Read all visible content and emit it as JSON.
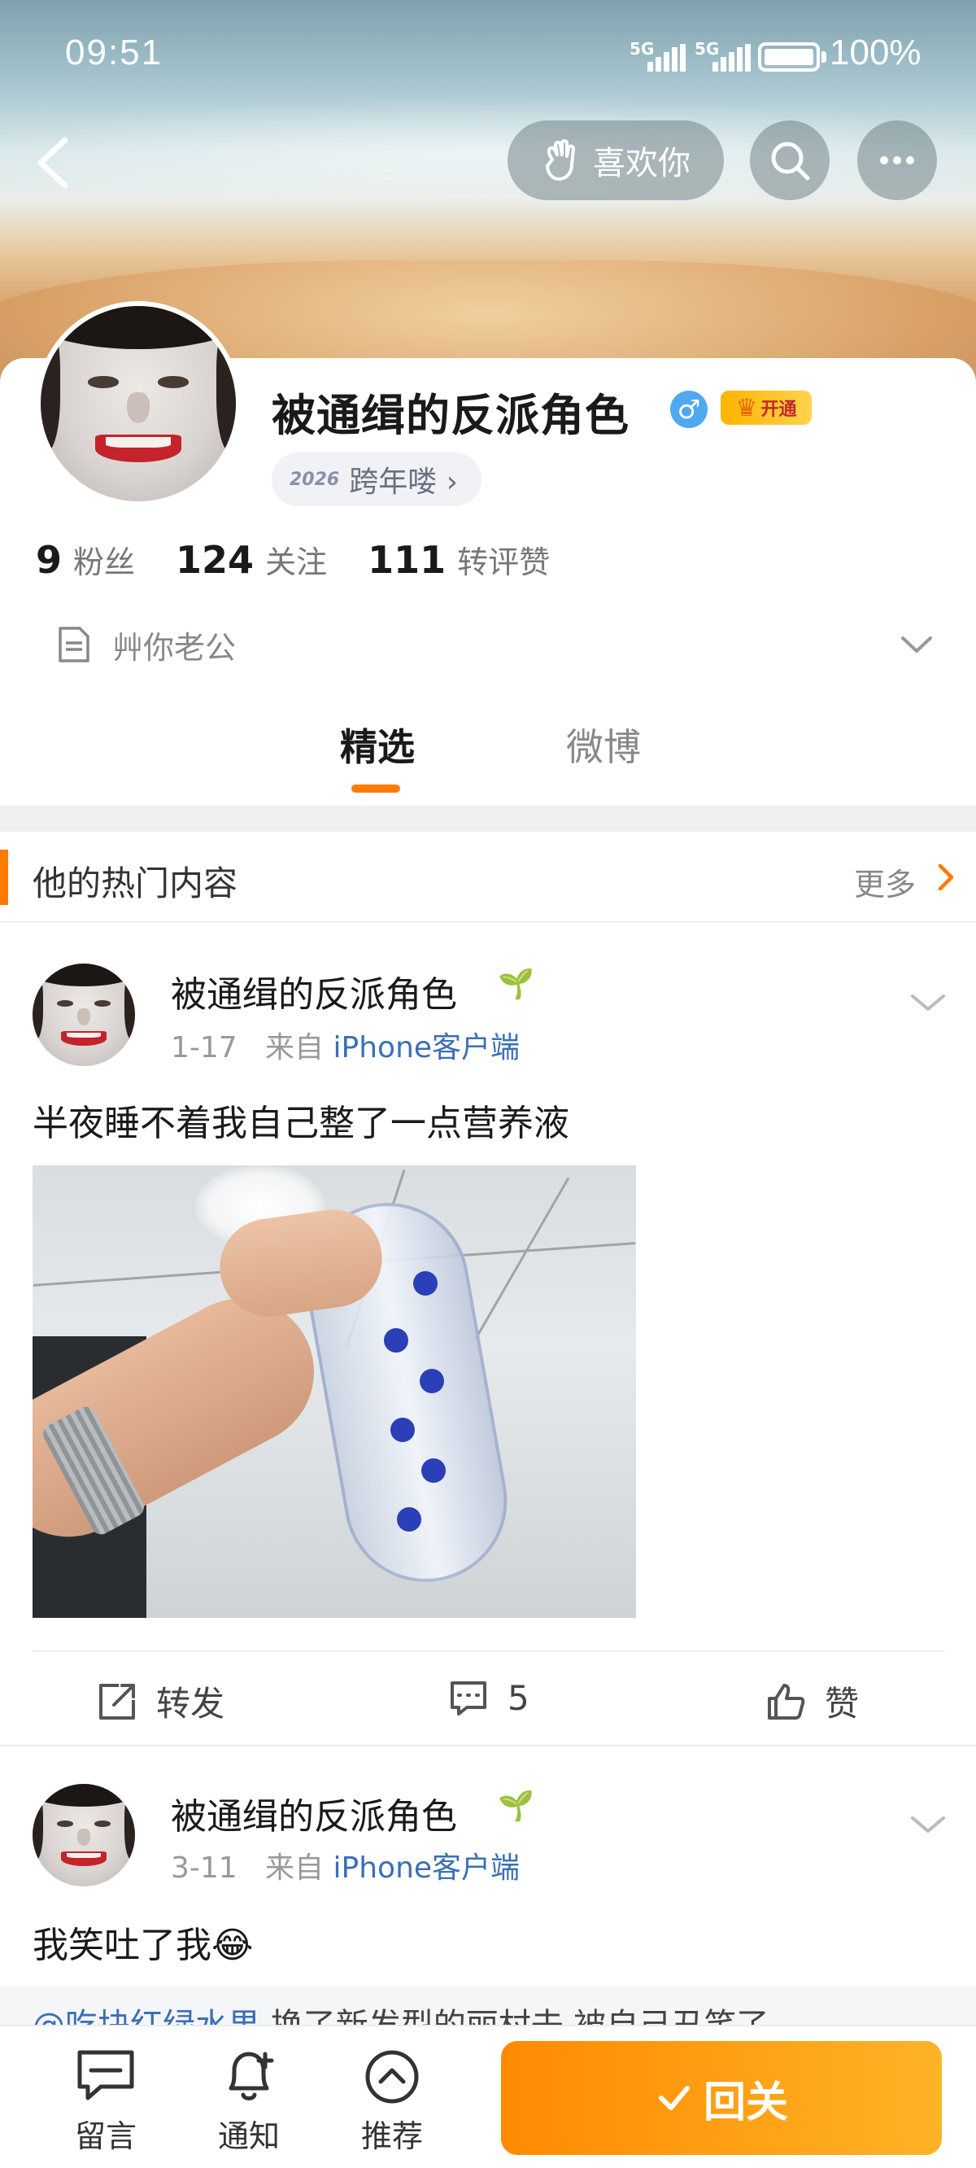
{
  "status_bar": {
    "time": "09:51",
    "network1": "5G",
    "network2": "5G",
    "battery": "100%"
  },
  "header": {
    "like_label": "喜欢你",
    "back_icon": "back-icon",
    "search_icon": "search-icon",
    "more_icon": "more-icon"
  },
  "profile": {
    "nickname": "被通缉的反派角色",
    "gender_icon": "♂",
    "vip_label": "开通",
    "year_badge_icon": "2026",
    "year_badge_label": "跨年喽 ›",
    "stats": [
      {
        "num": "9",
        "label": "粉丝"
      },
      {
        "num": "124",
        "label": "关注"
      },
      {
        "num": "111",
        "label": "转评赞"
      }
    ],
    "bio": "艸你老公"
  },
  "tabs": [
    {
      "label": "精选"
    },
    {
      "label": "微博"
    }
  ],
  "hot": {
    "title": "他的热门内容",
    "more": "更多"
  },
  "posts": [
    {
      "name": "被通缉的反派角色",
      "date": "1-17",
      "from": "来自",
      "source": "iPhone客户端",
      "text": "半夜睡不着我自己整了一点营养液",
      "repost_label": "转发",
      "comment_count": "5",
      "like_label": "赞"
    },
    {
      "name": "被通缉的反派角色",
      "date": "3-11",
      "from": "来自",
      "source": "iPhone客户端",
      "text": "我笑吐了我😂",
      "repost_mention": "@吃块红绿水果",
      "repost_text": " 换了新发型的丽村去 被自己丑笑了"
    }
  ],
  "bottom_bar": {
    "items": [
      {
        "label": "留言"
      },
      {
        "label": "通知"
      },
      {
        "label": "推荐"
      }
    ],
    "unfollow_label": "回关"
  },
  "colors": {
    "accent": "#ff7a00",
    "link": "#3b6fb6",
    "gender": "#4fa8f0"
  }
}
